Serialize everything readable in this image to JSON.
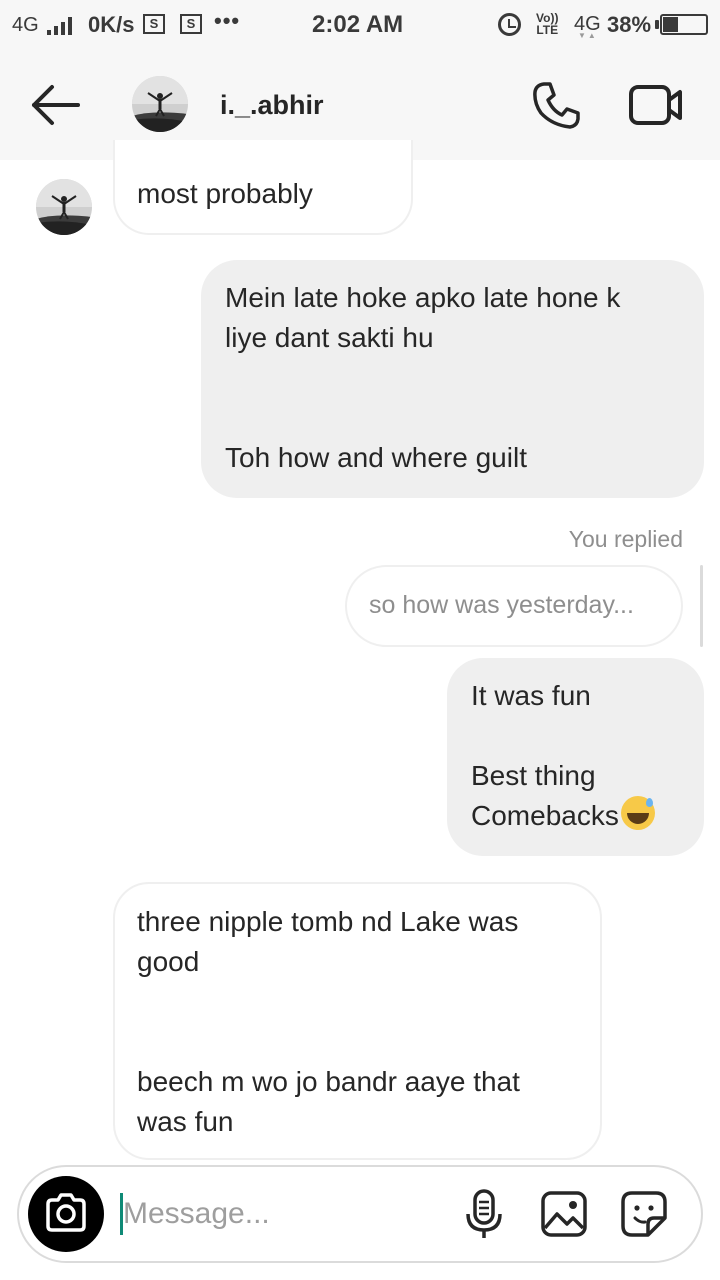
{
  "status_bar": {
    "network_left": "4G",
    "speed": "0K/s",
    "sim1": "S",
    "sim2": "S",
    "more_dots": "•••",
    "time": "2:02 AM",
    "volte_line1": "Vo))",
    "volte_line2": "LTE",
    "network_right": "4G",
    "battery_percent": "38%",
    "battery_level": 0.38
  },
  "header": {
    "username": "i._.abhir"
  },
  "messages": [
    {
      "side": "received",
      "text": "most probably"
    },
    {
      "side": "sent",
      "text": "Mein late hoke apko late hone k\nliye dant sakti hu\n\n\nToh how and where guilt"
    },
    {
      "side": "sent",
      "text": "It was fun\n\nBest thing\nComebacks"
    },
    {
      "side": "received",
      "text": "three nipple tomb nd Lake was\ngood\n\n\nbeech m wo jo bandr aaye that\nwas fun"
    }
  ],
  "reply": {
    "label": "You replied",
    "quoted": "so how was yesterday..."
  },
  "composer": {
    "placeholder": "Message..."
  },
  "colors": {
    "bar_bg": "#f7f7f7",
    "sent_bubble": "#efefef",
    "caret": "#0f8a76",
    "muted_text": "#8e8e8e"
  },
  "icons": [
    "back-arrow-icon",
    "phone-icon",
    "video-camera-icon",
    "camera-icon",
    "microphone-icon",
    "gallery-icon",
    "sticker-icon",
    "alarm-icon",
    "signal-icon",
    "battery-icon"
  ]
}
